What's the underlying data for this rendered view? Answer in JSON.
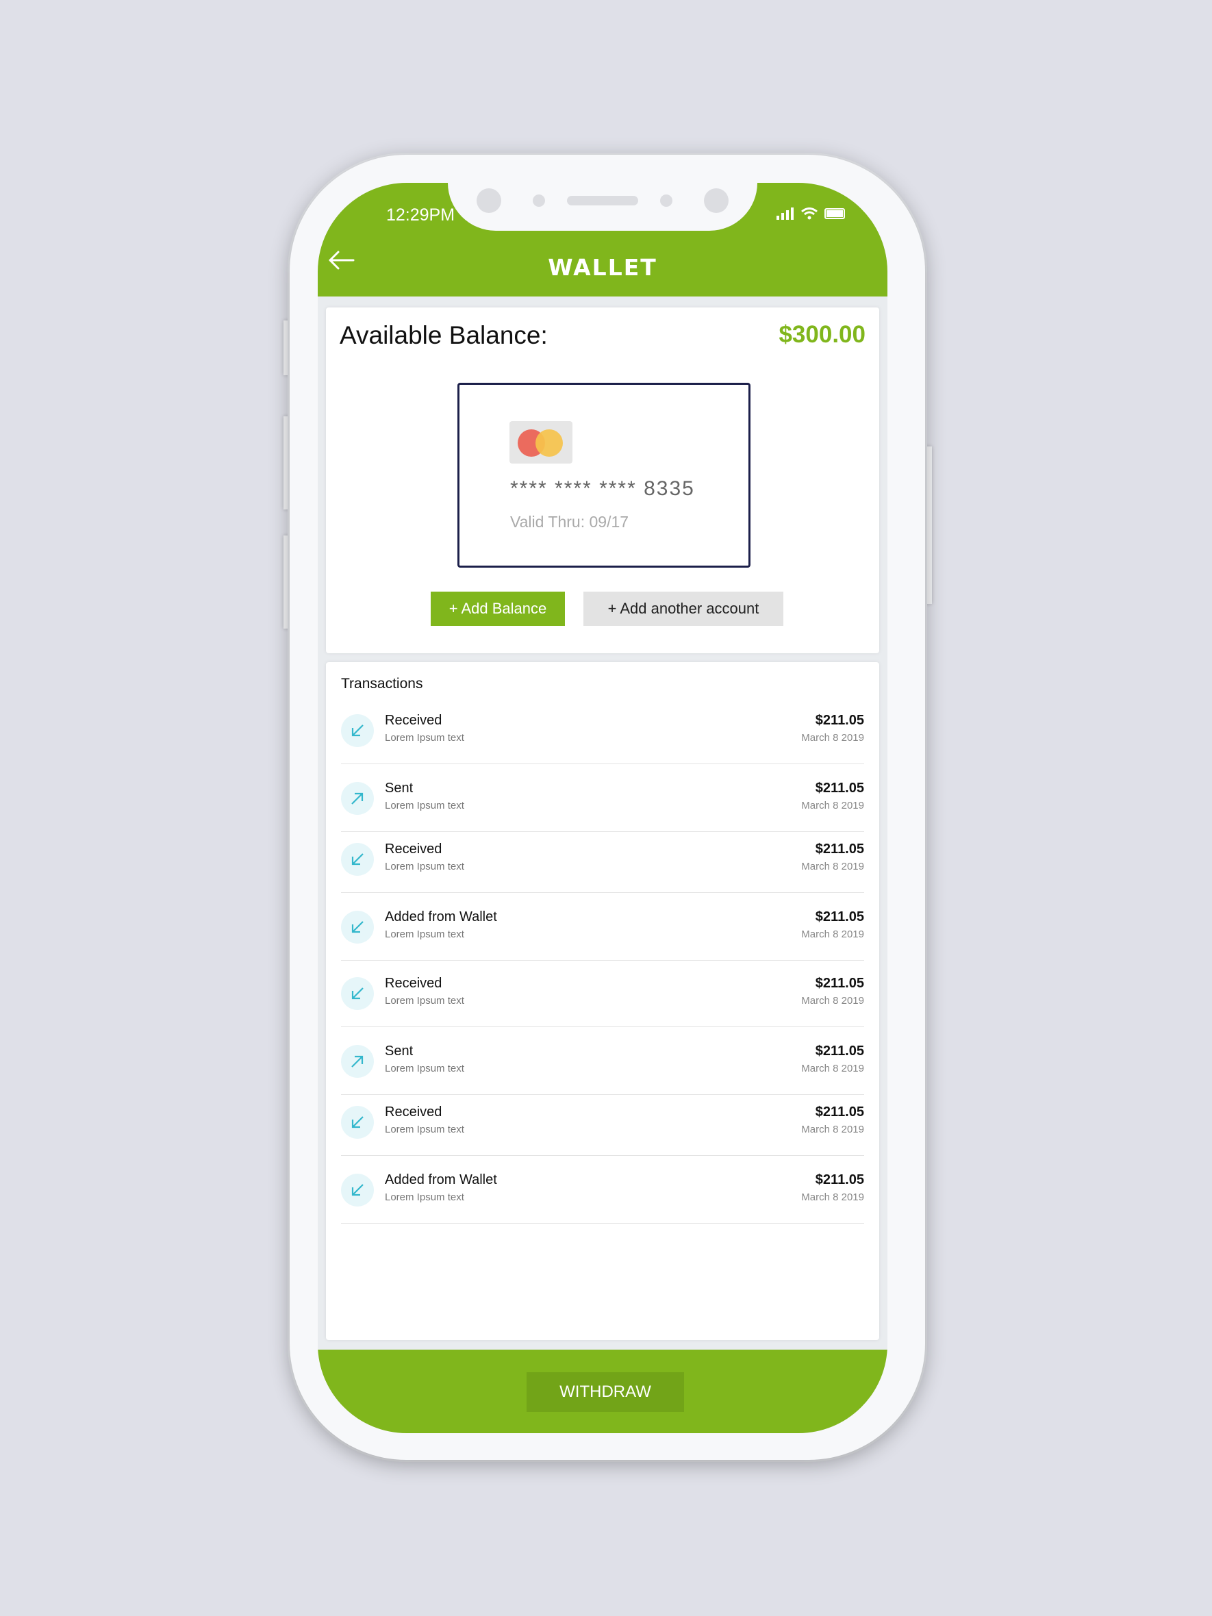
{
  "status_bar": {
    "time": "12:29PM"
  },
  "header": {
    "title": "WALLET",
    "back_icon": "arrow-left-icon"
  },
  "balance": {
    "label": "Available Balance:",
    "value": "$300.00"
  },
  "card": {
    "brand_icon": "mastercard-icon",
    "number": "**** **** **** 8335",
    "valid": "Valid Thru: 09/17"
  },
  "actions": {
    "add_balance": "+ Add Balance",
    "add_account": "+ Add another account"
  },
  "transactions": {
    "title": "Transactions",
    "items": [
      {
        "name": "Received",
        "sub": "Lorem Ipsum text",
        "amount": "$211.05",
        "date": "March 8 2019",
        "icon": "arrow-down-left-icon"
      },
      {
        "name": "Sent",
        "sub": "Lorem Ipsum text",
        "amount": "$211.05",
        "date": "March 8 2019",
        "icon": "arrow-up-right-icon"
      },
      {
        "name": "Received",
        "sub": "Lorem Ipsum text",
        "amount": "$211.05",
        "date": "March 8 2019",
        "icon": "arrow-down-left-icon"
      },
      {
        "name": "Added from Wallet",
        "sub": "Lorem Ipsum text",
        "amount": "$211.05",
        "date": "March 8 2019",
        "icon": "arrow-down-left-icon"
      },
      {
        "name": "Received",
        "sub": "Lorem Ipsum text",
        "amount": "$211.05",
        "date": "March 8 2019",
        "icon": "arrow-down-left-icon"
      },
      {
        "name": "Sent",
        "sub": "Lorem Ipsum text",
        "amount": "$211.05",
        "date": "March 8 2019",
        "icon": "arrow-up-right-icon"
      },
      {
        "name": "Received",
        "sub": "Lorem Ipsum text",
        "amount": "$211.05",
        "date": "March 8 2019",
        "icon": "arrow-down-left-icon"
      },
      {
        "name": "Added from Wallet",
        "sub": "Lorem Ipsum text",
        "amount": "$211.05",
        "date": "March 8 2019",
        "icon": "arrow-down-left-icon"
      }
    ]
  },
  "footer": {
    "withdraw": "WITHDRAW"
  },
  "colors": {
    "accent": "#80b61c",
    "icon_tint": "#33b7cc",
    "background": "#dfe0e8"
  }
}
